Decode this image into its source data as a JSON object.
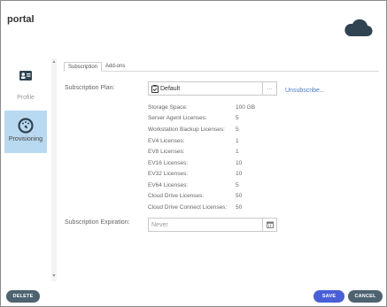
{
  "app": {
    "title": "portal"
  },
  "sidebar": {
    "items": [
      {
        "label": "Profile",
        "icon": "id-card-icon",
        "active": false
      },
      {
        "label": "Provisioning",
        "icon": "gauge-icon",
        "active": true
      }
    ]
  },
  "tabs": [
    {
      "label": "Subscription",
      "active": true
    },
    {
      "label": "Add-ons",
      "active": false
    }
  ],
  "form": {
    "plan_label": "Subscription Plan:",
    "plan_value": "Default",
    "plan_more": "...",
    "unsubscribe": "Unsubscribe...",
    "expiration_label": "Subscription Expiration:",
    "expiration_placeholder": "Never"
  },
  "details": [
    {
      "key": "Storage Space:",
      "value": "100 GB"
    },
    {
      "key": "Server Agent Licenses:",
      "value": "5"
    },
    {
      "key": "Workstation Backup Licenses:",
      "value": "5"
    },
    {
      "key": "EV4 Licenses:",
      "value": "1"
    },
    {
      "key": "EV8 Licenses:",
      "value": "1"
    },
    {
      "key": "EV16 Licenses:",
      "value": "10"
    },
    {
      "key": "EV32 Licenses:",
      "value": "10"
    },
    {
      "key": "EV64 Licenses:",
      "value": "5"
    },
    {
      "key": "Cloud Drive Licenses:",
      "value": "50"
    },
    {
      "key": "Cloud Drive Connect Licenses:",
      "value": "50"
    }
  ],
  "footer": {
    "delete": "DELETE",
    "save": "SAVE",
    "cancel": "CANCEL"
  },
  "colors": {
    "accent": "#4a5fd6",
    "active_sidebar": "#b9d9f0",
    "dark_button": "#4d6370",
    "link": "#4a7bc8"
  }
}
